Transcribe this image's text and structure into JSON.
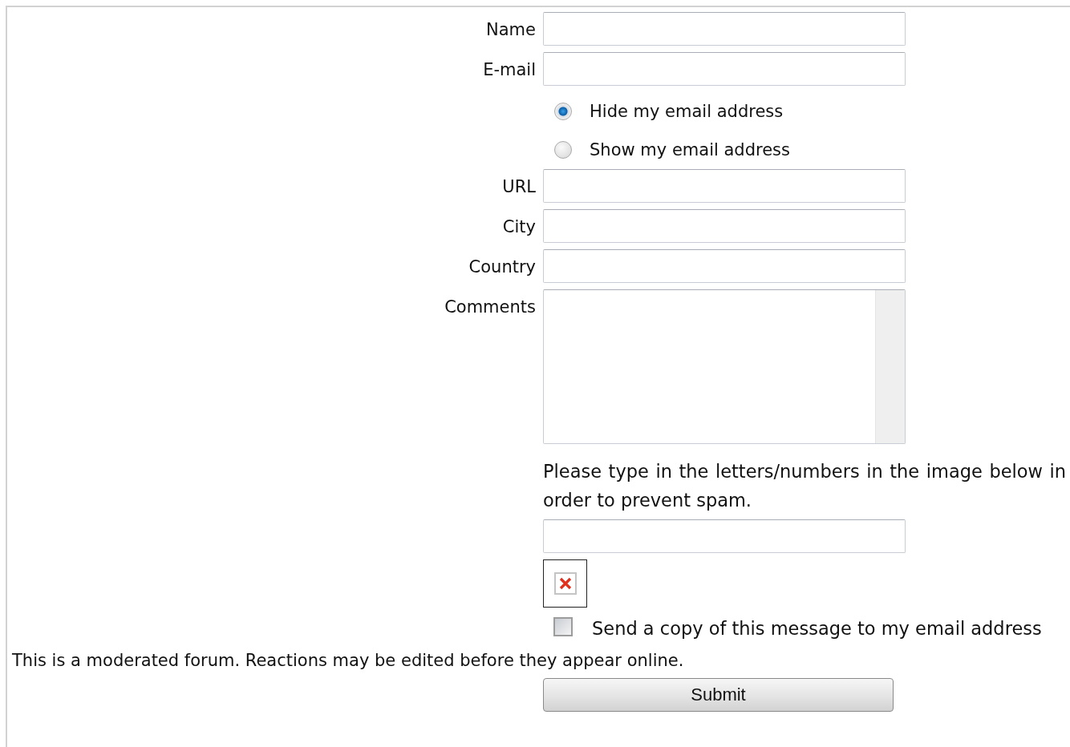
{
  "rows": [
    {
      "kind": "field",
      "label": "Name"
    },
    {
      "kind": "field",
      "label": "E-mail"
    },
    {
      "kind": "radio",
      "label": "Hide my email address",
      "selected": true
    },
    {
      "kind": "radio",
      "label": "Show my email address",
      "selected": false
    },
    {
      "kind": "field",
      "label": "URL"
    },
    {
      "kind": "field",
      "label": "City"
    },
    {
      "kind": "field",
      "label": "Country"
    },
    {
      "kind": "textarea",
      "label": "Comments"
    }
  ],
  "captcha": {
    "instruction": "Please type in the letters/numbers in the image below in order to prevent spam."
  },
  "copy_option": {
    "label": "Send a copy of this message to my email address",
    "checked": false
  },
  "notice": "This is a moderated forum. Reactions may be edited before they appear online.",
  "submit": "Submit"
}
